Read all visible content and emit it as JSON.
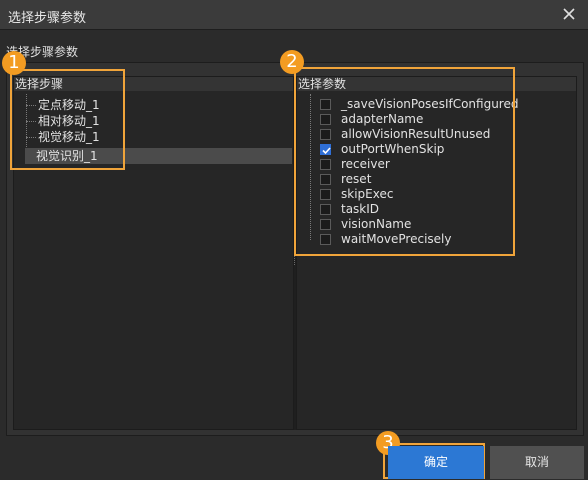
{
  "window": {
    "title": "选择步骤参数"
  },
  "section_label": "选择步骤参数",
  "steps_pane": {
    "title": "选择步骤",
    "items": [
      "定点移动_1",
      "相对移动_1",
      "视觉移动_1",
      "视觉识别_1"
    ],
    "selected_index": 3
  },
  "params_pane": {
    "title": "选择参数",
    "items": [
      {
        "label": "_saveVisionPosesIfConfigured",
        "checked": false
      },
      {
        "label": "adapterName",
        "checked": false
      },
      {
        "label": "allowVisionResultUnused",
        "checked": false
      },
      {
        "label": "outPortWhenSkip",
        "checked": true
      },
      {
        "label": "receiver",
        "checked": false
      },
      {
        "label": "reset",
        "checked": false
      },
      {
        "label": "skipExec",
        "checked": false
      },
      {
        "label": "taskID",
        "checked": false
      },
      {
        "label": "visionName",
        "checked": false
      },
      {
        "label": "waitMovePrecisely",
        "checked": false
      }
    ]
  },
  "buttons": {
    "ok": "确定",
    "cancel": "取消"
  },
  "badges": [
    "1",
    "2",
    "3"
  ],
  "colors": {
    "highlight": "#f0a43a",
    "badge": "#f39c22",
    "primary": "#2c78d4",
    "checkbox_checked": "#2f6fd6"
  },
  "icons": {
    "close": "close-icon",
    "check": "check-icon"
  }
}
